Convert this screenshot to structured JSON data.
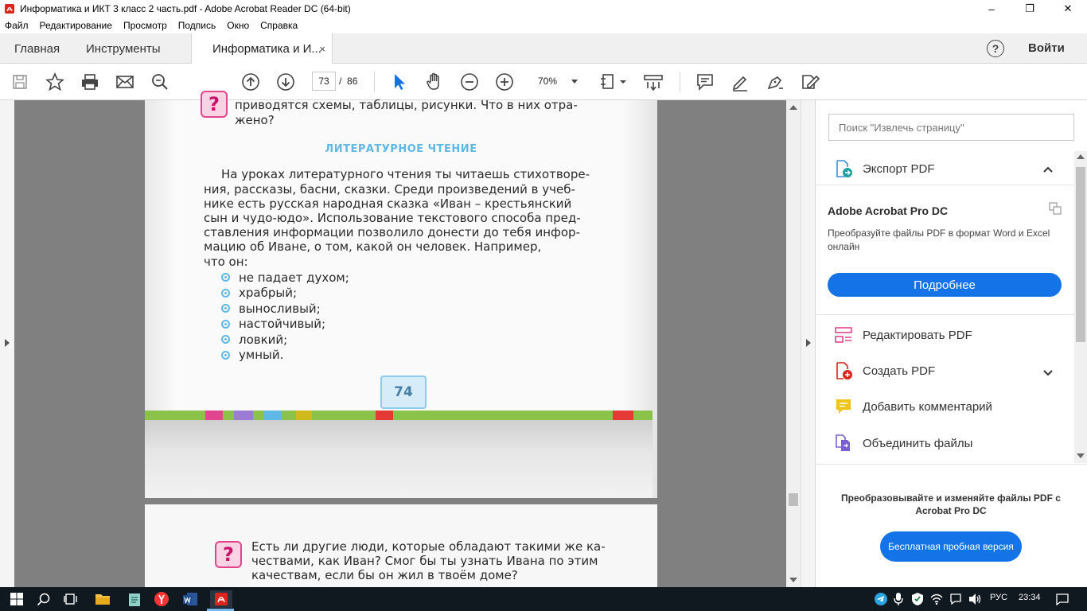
{
  "window": {
    "title": "Информатика и ИКТ 3 класс 2 часть.pdf - Adobe Acrobat Reader DC (64-bit)",
    "controls": [
      "–",
      "❐",
      "✕"
    ]
  },
  "menu": [
    "Файл",
    "Редактирование",
    "Просмотр",
    "Подпись",
    "Окно",
    "Справка"
  ],
  "tabs": {
    "home": "Главная",
    "tools": "Инструменты",
    "document": "Информатика и И...",
    "close": "×",
    "help": "?",
    "signin": "Войти"
  },
  "toolbar": {
    "current_page": "73",
    "page_separator": "/",
    "total_pages": "86",
    "zoom": "70%"
  },
  "page1": {
    "intro_line1": "приводятся схемы, таблицы, рисунки. Что в них отра-",
    "intro_line2": "жено?",
    "heading": "ЛИТЕРАТУРНОЕ ЧТЕНИЕ",
    "paragraph": [
      "На уроках литературного чтения ты читаешь стихотворе-",
      "ния, рассказы, басни, сказки. Среди произведений в учеб-",
      "нике есть русская народная сказка «Иван – крестьянский",
      "сын и чудо-юдо». Использование текстового способа пред-",
      "ставления информации позволило донести до тебя инфор-",
      "мацию об Иване, о том, какой он человек. Например,",
      "что он:"
    ],
    "bullets": [
      "не падает духом;",
      "храбрый;",
      "выносливый;",
      "настойчивый;",
      "ловкий;",
      "умный."
    ],
    "page_number": "74",
    "stripe_colors": [
      "#8bc34a",
      "#e0458e",
      "#9c7bd4",
      "#5fb8e6",
      "#e53935",
      "#ffb300"
    ]
  },
  "page2": {
    "question_lines": [
      "Есть ли другие люди, которые обладают такими же ка-",
      "чествами, как Иван? Смог бы ты узнать Ивана по этим",
      "качествам, если бы он жил в твоём доме?"
    ]
  },
  "right_panel": {
    "search_placeholder": "Поиск \"Извлечь страницу\"",
    "export": "Экспорт PDF",
    "pro_title": "Adobe Acrobat Pro DC",
    "pro_desc": "Преобразуйте файлы PDF в формат Word и Excel онлайн",
    "pro_button": "Подробнее",
    "items": [
      "Редактировать PDF",
      "Создать PDF",
      "Добавить комментарий",
      "Объединить файлы"
    ],
    "promo_title": "Преобразовывайте и изменяйте файлы PDF с Acrobat Pro DC",
    "promo_button": "Бесплатная пробная версия"
  },
  "taskbar": {
    "language": "РУС",
    "time": "23:34"
  },
  "colors": {
    "accent_blue": "#1473e6",
    "acrobat_red": "#d9261c",
    "heading_blue": "#5fb8e6",
    "question_pink": "#e0458e"
  }
}
